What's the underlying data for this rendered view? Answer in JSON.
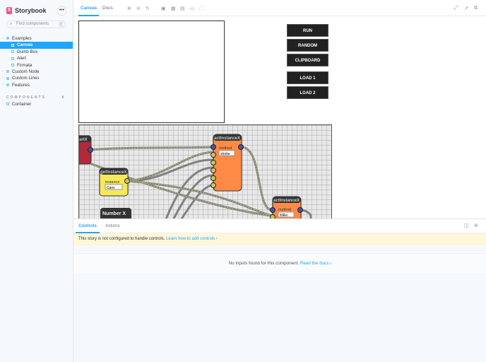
{
  "sidebar": {
    "brand": "Storybook",
    "more_label": "•••",
    "search_placeholder": "Find components",
    "search_shortcut": "/",
    "tree": [
      {
        "label": "Examples",
        "type": "group",
        "level": 0
      },
      {
        "label": "Canvas",
        "type": "story",
        "level": 1,
        "selected": true
      },
      {
        "label": "Dumb Box",
        "type": "story",
        "level": 1
      },
      {
        "label": "Alert",
        "type": "story",
        "level": 1
      },
      {
        "label": "Firmata",
        "type": "story",
        "level": 1
      },
      {
        "label": "Custom Node",
        "type": "group",
        "level": 0
      },
      {
        "label": "Custom Lines",
        "type": "group",
        "level": 0
      },
      {
        "label": "Features",
        "type": "group",
        "level": 0
      }
    ],
    "section_title": "COMPONENTS",
    "section_items": [
      {
        "label": "Container"
      }
    ]
  },
  "toolbar": {
    "tabs": [
      {
        "label": "Canvas",
        "active": true
      },
      {
        "label": "Docs"
      }
    ],
    "tools": [
      "zoom-in-icon",
      "zoom-out-icon",
      "zoom-reset-icon",
      "background-icon",
      "grid-icon",
      "viewport-icon",
      "outline-icon",
      "measure-icon"
    ],
    "right_tools": [
      "fullscreen-icon",
      "open-new-tab-icon",
      "copy-link-icon"
    ]
  },
  "preview": {
    "buttons": [
      "RUN",
      "RANDOM",
      "CLIPBOARD",
      "LOAD 1",
      "LOAD 2"
    ],
    "nodes": {
      "start": {
        "title": "artX",
        "color": "#b02a3a"
      },
      "get": {
        "title": "getInstanceX",
        "label": "instance",
        "select": "Canv",
        "color": "#f5e85a"
      },
      "act1": {
        "title": "actInstanceX",
        "label": "method",
        "select": "stroke",
        "color": "#ff8a45"
      },
      "act2": {
        "title": "actInstanceX",
        "label": "method",
        "select": "fillRe",
        "color": "#ff8a45"
      },
      "num": {
        "title": "Number X"
      }
    }
  },
  "panel": {
    "tabs": [
      {
        "label": "Controls",
        "active": true
      },
      {
        "label": "Actions"
      }
    ],
    "warning": "This story is not configured to handle controls.",
    "warning_link": "Learn how to add controls ›",
    "empty": "No inputs found for this component.",
    "empty_link": "Read the docs ›"
  }
}
